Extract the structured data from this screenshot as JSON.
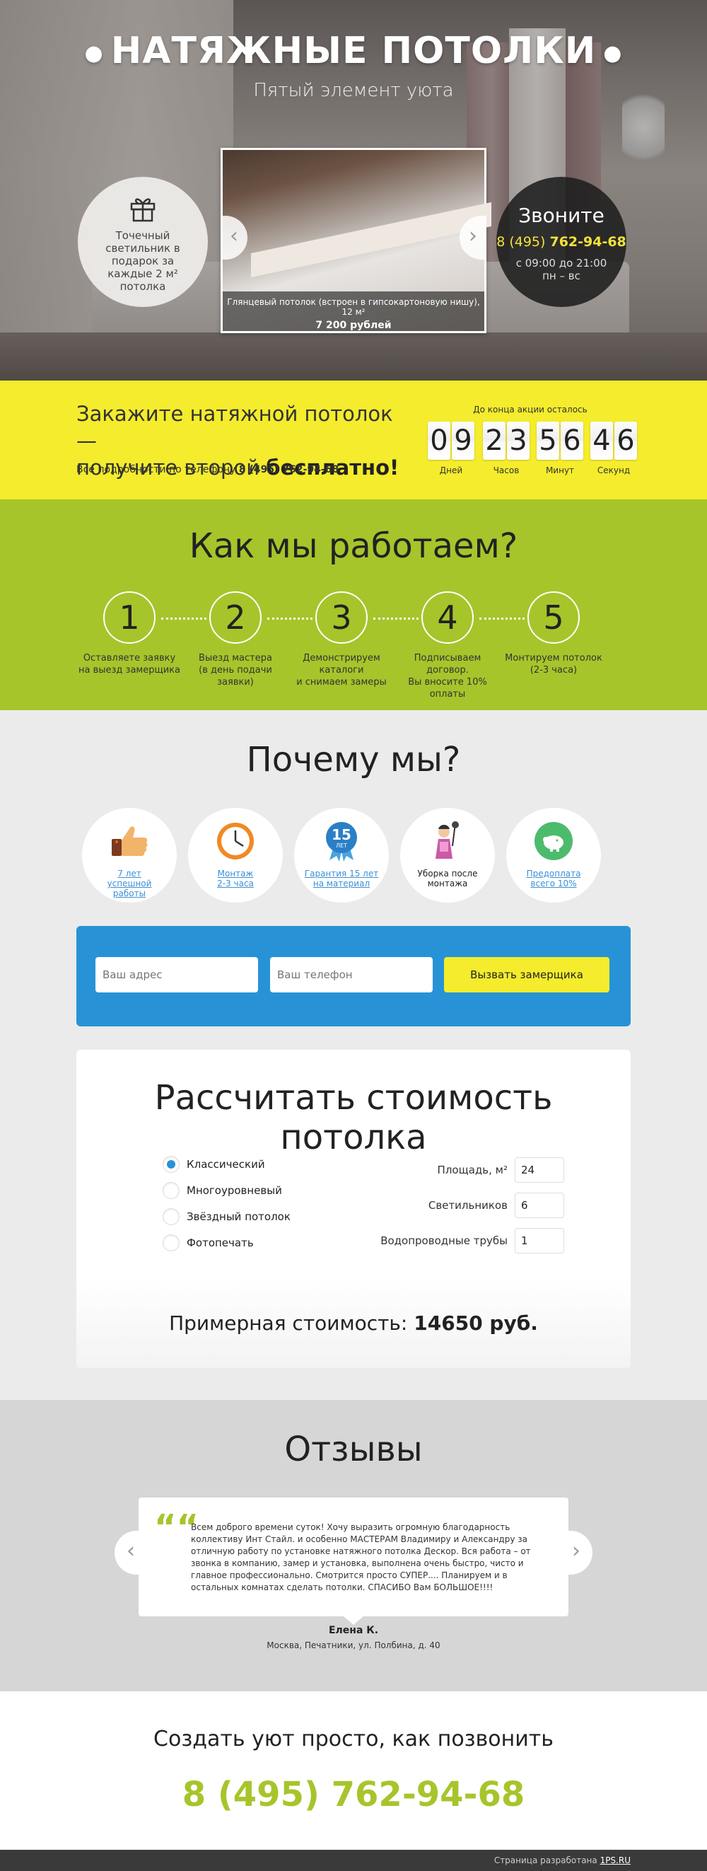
{
  "hero": {
    "title": "НАТЯЖНЫЕ ПОТОЛКИ",
    "subtitle": "Пятый элемент уюта",
    "gift_text": "Точечный светильник в подарок за каждые 2 м² потолка",
    "slide_caption": "Глянцевый потолок (встроен в гипсокартоновую нишу), 12 м²",
    "slide_price": "7 200 рублей",
    "call_title": "Звоните",
    "call_phone_prefix": "8 (495) ",
    "call_phone_main": "762-94-68",
    "call_hours": "с 09:00 до 21:00",
    "call_days": "пн – вс"
  },
  "promo": {
    "headline_1": "Закажите натяжной потолок —",
    "headline_2": "получите второй ",
    "headline_bold": "бесплатно!",
    "details": "Все подробности по телефону ",
    "details_phone": "8 (495) 762-94-68",
    "countdown_label": "До конца акции осталось",
    "countdown": [
      {
        "digits": [
          "0",
          "9"
        ],
        "label": "Дней"
      },
      {
        "digits": [
          "2",
          "3"
        ],
        "label": "Часов"
      },
      {
        "digits": [
          "5",
          "6"
        ],
        "label": "Минут"
      },
      {
        "digits": [
          "4",
          "6"
        ],
        "label": "Секунд"
      }
    ]
  },
  "how": {
    "title": "Как мы работаем?",
    "steps": [
      {
        "num": "1",
        "line1": "Оставляете заявку",
        "line2": "на выезд замерщика",
        "line3": ""
      },
      {
        "num": "2",
        "line1": "Выезд мастера",
        "line2": "(в день подачи заявки)",
        "line3": ""
      },
      {
        "num": "3",
        "line1": "Демонстрируем",
        "line2": "каталоги",
        "line3": "и снимаем замеры"
      },
      {
        "num": "4",
        "line1": "Подписываем договор.",
        "line2": "Вы вносите 10% оплаты",
        "line3": ""
      },
      {
        "num": "5",
        "line1": "Монтируем потолок",
        "line2": "(2-3 часа)",
        "line3": ""
      }
    ]
  },
  "why": {
    "title": "Почему мы?",
    "items": [
      {
        "icon": "thumbs-up-icon",
        "l1": "7 лет",
        "l2": "успешной",
        "l3": "работы"
      },
      {
        "icon": "clock-icon",
        "l1": "Монтаж",
        "l2": "2-3 часа",
        "l3": ""
      },
      {
        "icon": "guarantee-badge-icon",
        "badge_num": "15",
        "badge_sub": "ЛЕТ",
        "l1": "Гарантия 15 лет",
        "l2": "на материал",
        "l3": ""
      },
      {
        "icon": "cleaner-icon",
        "l1": "Уборка после",
        "l2": "монтажа",
        "l3": ""
      },
      {
        "icon": "piggy-bank-icon",
        "l1": "Предоплата",
        "l2": "всего 10%",
        "l3": ""
      }
    ],
    "form": {
      "address_placeholder": "Ваш адрес",
      "phone_placeholder": "Ваш телефон",
      "button": "Вызвать замерщика"
    }
  },
  "calc": {
    "title": "Рассчитать стоимость потолка",
    "types": [
      "Классический",
      "Многоуровневый",
      "Звёздный потолок",
      "Фотопечать"
    ],
    "selected_type": "Классический",
    "fields": [
      {
        "label": "Площадь, м²",
        "value": "24"
      },
      {
        "label": "Светильников",
        "value": "6"
      },
      {
        "label": "Водопроводные трубы",
        "value": "1"
      }
    ],
    "total_label": "Примерная стоимость: ",
    "total_value": "14650 руб."
  },
  "reviews": {
    "title": "Отзывы",
    "quote_mark": "““",
    "text": "Всем доброго времени суток! Хочу выразить огромную благодарность коллективу Инт Стайл. и особенно МАСТЕРАМ Владимиру и Александру за отличную работу по установке натяжного потолка Дескор. Вся работа – от звонка в компанию, замер и установка, выполнена очень быстро, чисто и главное профессионально. Смотрится просто СУПЕР.... Планируем и в остальных комнатах сделать потолки. СПАСИБО Вам БОЛЬШОЕ!!!!",
    "author": "Елена К.",
    "address": "Москва, Печатники, ул. Полбина, д. 40"
  },
  "bottom": {
    "tagline": "Создать уют просто, как позвонить",
    "phone": "8 (495) 762-94-68"
  },
  "footer": {
    "text": "Страница разработана ",
    "link": "1PS.RU"
  },
  "colors": {
    "yellow": "#f4ec2c",
    "green": "#a6c52b",
    "blue": "#2793d6",
    "grey": "#ebebeb"
  }
}
